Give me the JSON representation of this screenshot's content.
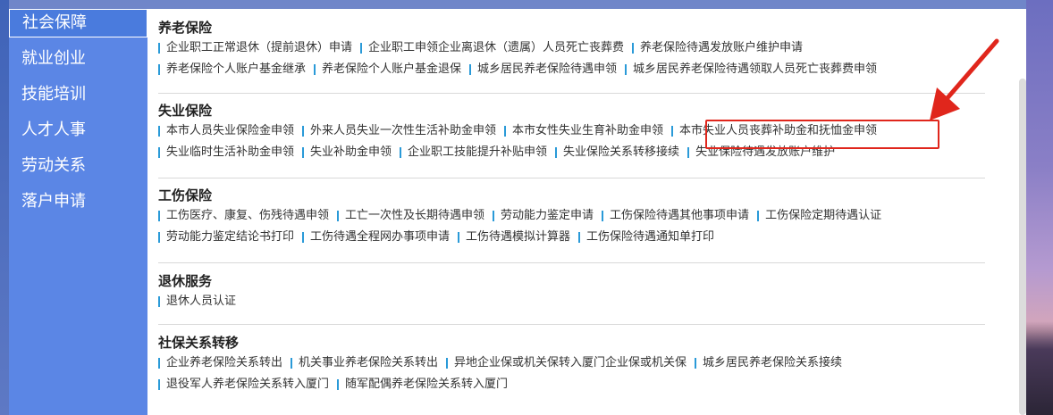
{
  "sidebar": {
    "items": [
      {
        "label": "社会保障",
        "active": true
      },
      {
        "label": "就业创业",
        "active": false
      },
      {
        "label": "技能培训",
        "active": false
      },
      {
        "label": "人才人事",
        "active": false
      },
      {
        "label": "劳动关系",
        "active": false
      },
      {
        "label": "落户申请",
        "active": false
      }
    ]
  },
  "sections": [
    {
      "title": "养老保险",
      "rows": [
        [
          "企业职工正常退休（提前退休）申请",
          "企业职工申领企业离退休（遗属）人员死亡丧葬费",
          "养老保险待遇发放账户维护申请"
        ],
        [
          "养老保险个人账户基金继承",
          "养老保险个人账户基金退保",
          "城乡居民养老保险待遇申领",
          "城乡居民养老保险待遇领取人员死亡丧葬费申领"
        ]
      ]
    },
    {
      "title": "失业保险",
      "rows": [
        [
          "本市人员失业保险金申领",
          "外来人员失业一次性生活补助金申领",
          "本市女性失业生育补助金申领",
          "本市失业人员丧葬补助金和抚恤金申领"
        ],
        [
          "失业临时生活补助金申领",
          "失业补助金申领",
          "企业职工技能提升补贴申领",
          "失业保险关系转移接续",
          "失业保险待遇发放账户维护"
        ]
      ]
    },
    {
      "title": "工伤保险",
      "rows": [
        [
          "工伤医疗、康复、伤残待遇申领",
          "工亡一次性及长期待遇申领",
          "劳动能力鉴定申请",
          "工伤保险待遇其他事项申请",
          "工伤保险定期待遇认证"
        ],
        [
          "劳动能力鉴定结论书打印",
          "工伤待遇全程网办事项申请",
          "工伤待遇模拟计算器",
          "工伤保险待遇通知单打印"
        ]
      ]
    },
    {
      "title": "退休服务",
      "rows": [
        [
          "退休人员认证"
        ]
      ]
    },
    {
      "title": "社保关系转移",
      "rows": [
        [
          "企业养老保险关系转出",
          "机关事业养老保险关系转出",
          "异地企业保或机关保转入厦门企业保或机关保",
          "城乡居民养老保险关系接续"
        ],
        [
          "退役军人养老保险关系转入厦门",
          "随军配偶养老保险关系转入厦门"
        ]
      ]
    }
  ],
  "colors": {
    "sidebar_bg": "#5b86e5",
    "link_bar": "#2a9ad8",
    "highlight": "#e0261c"
  }
}
